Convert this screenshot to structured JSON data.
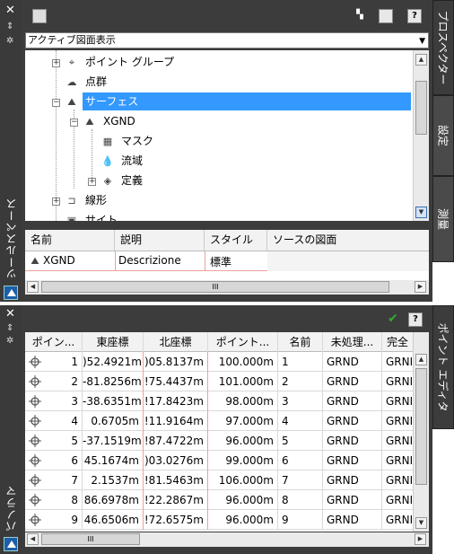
{
  "prospector": {
    "toolbar_buttons": [
      "window-icon",
      "tree-view-icon",
      "panel-icon",
      "help"
    ],
    "help_label": "?",
    "view_combo": "アクティブ図面表示",
    "tree": [
      {
        "label": "ポイント グループ",
        "icon": "point-group-icon"
      },
      {
        "label": "点群",
        "icon": "point-cloud-icon"
      },
      {
        "label": "サーフェス",
        "icon": "surface-icon",
        "selected": true
      },
      {
        "label": "XGND",
        "icon": "surface-icon"
      },
      {
        "label": "マスク",
        "icon": "mask-icon"
      },
      {
        "label": "流域",
        "icon": "watershed-icon"
      },
      {
        "label": "定義",
        "icon": "definition-icon"
      },
      {
        "label": "線形",
        "icon": "alignment-icon"
      },
      {
        "label": "サイト",
        "icon": "site-icon"
      }
    ],
    "list_headers": [
      "名前",
      "説明",
      "スタイル",
      "ソースの図面"
    ],
    "list_rows": [
      {
        "name": "XGND",
        "description": "Descrizione",
        "style": "標準",
        "source": ""
      }
    ],
    "hscroll_grip": "III",
    "side_label": "ツールスペース",
    "tabs": [
      "プロスペクター",
      "設定",
      "測量"
    ]
  },
  "point_editor": {
    "side_label": "パノラマ",
    "tab": "ポイント エディタ",
    "help_label": "?",
    "check_icon": "checkmark-icon",
    "headers": [
      "ポイン...",
      "東座標",
      "北座標",
      "ポイント...",
      "名前",
      "未処理...",
      "完全"
    ],
    "rows": [
      [
        "1",
        ")52.4921m",
        ")05.8137m",
        "100.000m",
        "1",
        "GRND",
        "GRNI"
      ],
      [
        "2",
        "-81.8256m",
        "!75.4437m",
        "101.000m",
        "2",
        "GRND",
        "GRNI"
      ],
      [
        "3",
        "-38.6351m",
        "!17.8423m",
        "98.000m",
        "3",
        "GRND",
        "GRNI"
      ],
      [
        "4",
        "0.6705m",
        "!11.9164m",
        "97.000m",
        "4",
        "GRND",
        "GRNI"
      ],
      [
        "5",
        "-37.1519m",
        "!87.4722m",
        "96.000m",
        "5",
        "GRND",
        "GRNI"
      ],
      [
        "6",
        "45.1674m",
        ")03.0276m",
        "99.000m",
        "6",
        "GRND",
        "GRNI"
      ],
      [
        "7",
        "2.1537m",
        "!81.5463m",
        "106.000m",
        "7",
        "GRND",
        "GRNI"
      ],
      [
        "8",
        "86.6978m",
        "!22.2867m",
        "96.000m",
        "8",
        "GRND",
        "GRNI"
      ],
      [
        "9",
        "46.6506m",
        "!72.6575m",
        "96.000m",
        "9",
        "GRND",
        "GRNI"
      ]
    ],
    "hscroll_grip": "III"
  },
  "colors": {
    "chrome": "#3c3c3c",
    "selection": "#3399ff",
    "check": "#3aa63a"
  }
}
